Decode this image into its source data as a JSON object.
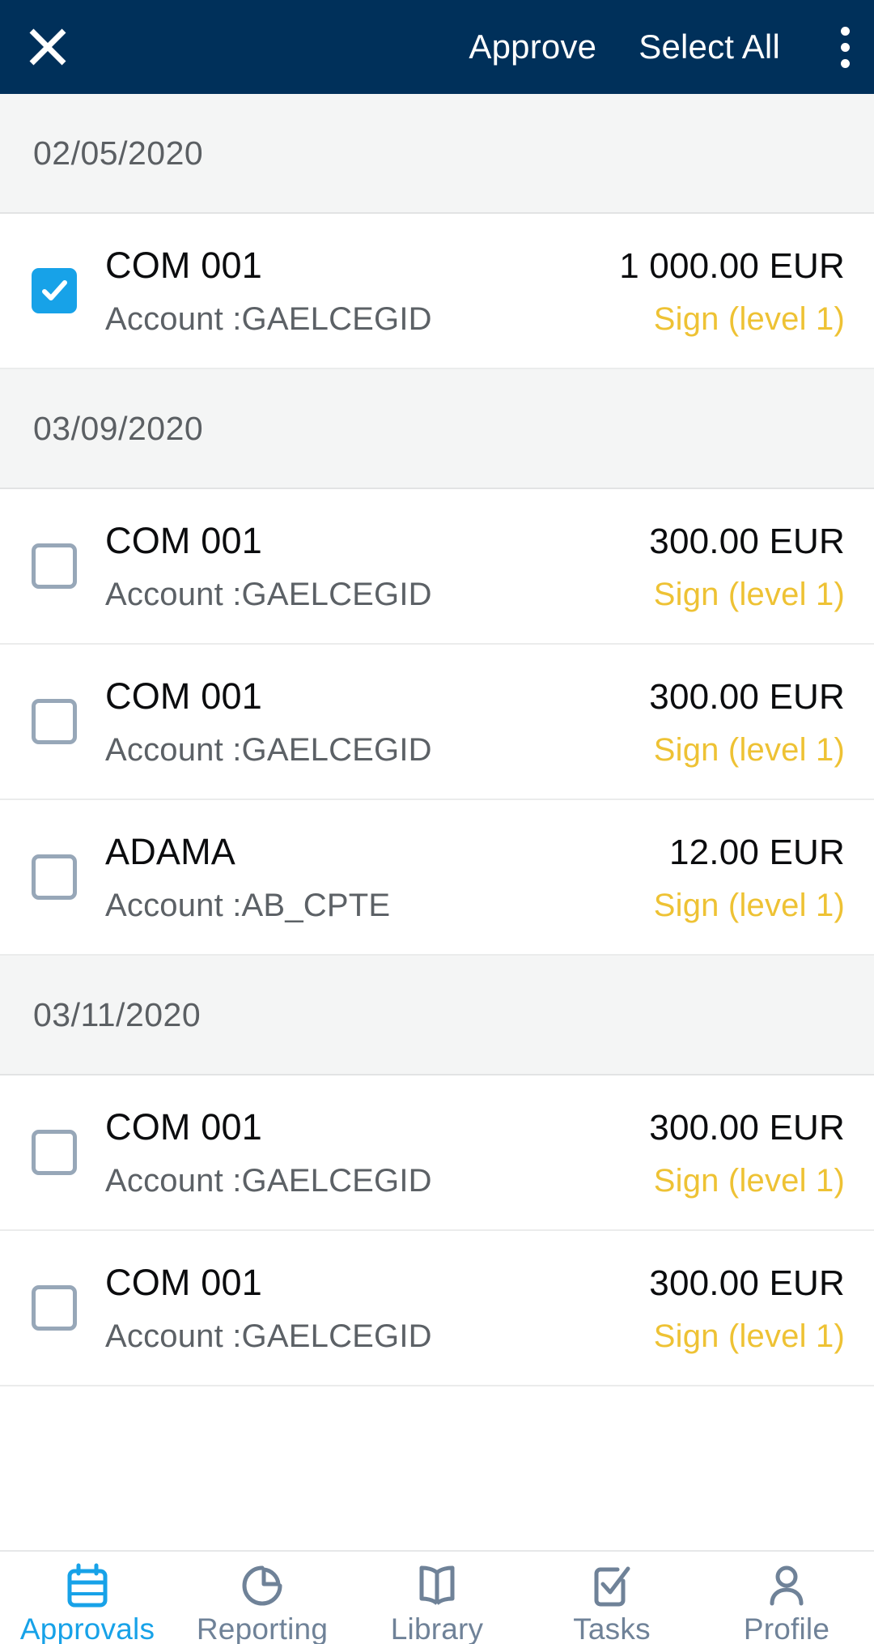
{
  "colors": {
    "appbar_bg": "#00305A",
    "accent_blue": "#17A2E8",
    "status_yellow": "#EEC234",
    "nav_inactive": "#6F8298",
    "date_header_bg": "#F4F5F5",
    "checkbox_border": "#97A7B8"
  },
  "appbar": {
    "close_icon": "close-icon",
    "approve_label": "Approve",
    "select_all_label": "Select All",
    "overflow_icon": "more-vertical-icon"
  },
  "list": {
    "account_prefix": "Account :",
    "sections": [
      {
        "date": "02/05/2020",
        "rows": [
          {
            "title": "COM 001",
            "account": "Account :GAELCEGID",
            "amount": "1 000.00 EUR",
            "status": "Sign (level 1)",
            "checked": true
          }
        ]
      },
      {
        "date": "03/09/2020",
        "rows": [
          {
            "title": "COM 001",
            "account": "Account :GAELCEGID",
            "amount": "300.00 EUR",
            "status": "Sign (level 1)",
            "checked": false
          },
          {
            "title": "COM 001",
            "account": "Account :GAELCEGID",
            "amount": "300.00 EUR",
            "status": "Sign (level 1)",
            "checked": false
          },
          {
            "title": "ADAMA",
            "account": "Account :AB_CPTE",
            "amount": "12.00 EUR",
            "status": "Sign (level 1)",
            "checked": false
          }
        ]
      },
      {
        "date": "03/11/2020",
        "rows": [
          {
            "title": "COM 001",
            "account": "Account :GAELCEGID",
            "amount": "300.00 EUR",
            "status": "Sign (level 1)",
            "checked": false
          },
          {
            "title": "COM 001",
            "account": "Account :GAELCEGID",
            "amount": "300.00 EUR",
            "status": "Sign (level 1)",
            "checked": false
          }
        ]
      }
    ]
  },
  "bottom_nav": {
    "active_index": 0,
    "items": [
      {
        "label": "Approvals",
        "icon": "calendar-icon"
      },
      {
        "label": "Reporting",
        "icon": "pie-chart-icon"
      },
      {
        "label": "Library",
        "icon": "book-icon"
      },
      {
        "label": "Tasks",
        "icon": "checklist-icon"
      },
      {
        "label": "Profile",
        "icon": "person-icon"
      }
    ]
  }
}
